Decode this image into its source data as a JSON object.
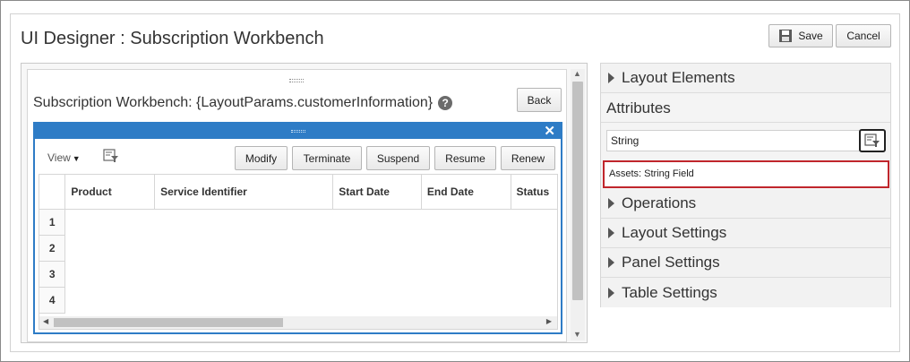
{
  "header": {
    "title": "UI Designer : Subscription Workbench",
    "save_label": "Save",
    "cancel_label": "Cancel"
  },
  "canvas": {
    "subtitle": "Subscription Workbench: {LayoutParams.customerInformation}",
    "help_glyph": "?",
    "back_label": "Back",
    "panel": {
      "close_glyph": "✕",
      "view_label": "View",
      "buttons": [
        "Modify",
        "Terminate",
        "Suspend",
        "Resume",
        "Renew"
      ],
      "columns": [
        "Product",
        "Service Identifier",
        "Start Date",
        "End Date",
        "Status"
      ],
      "rows": [
        "1",
        "2",
        "3",
        "4"
      ]
    }
  },
  "sidebar": {
    "layout_elements": "Layout Elements",
    "attributes_label": "Attributes",
    "search_value": "String",
    "asset_item": "Assets: String Field",
    "sections": [
      "Operations",
      "Layout Settings",
      "Panel Settings",
      "Table Settings"
    ]
  },
  "colors": {
    "panel_accent": "#2e7cc6",
    "highlight": "#c0262c"
  }
}
